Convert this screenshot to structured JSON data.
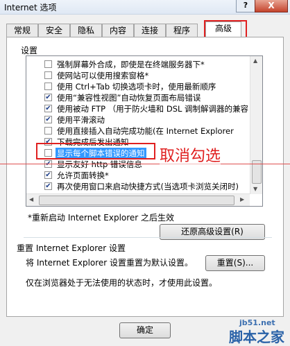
{
  "window": {
    "title": "Internet 选项",
    "help_glyph": "?",
    "close_glyph": "X"
  },
  "tabs": [
    {
      "label": "常规"
    },
    {
      "label": "安全"
    },
    {
      "label": "隐私"
    },
    {
      "label": "内容"
    },
    {
      "label": "连接"
    },
    {
      "label": "程序"
    },
    {
      "label": "高级",
      "active": true
    }
  ],
  "settings_label": "设置",
  "settings_items": [
    {
      "label": "强制屏幕外合成，即使是在终端服务器下*",
      "checked": false
    },
    {
      "label": "使网站可以使用搜索窗格*",
      "checked": false
    },
    {
      "label": "使用 Ctrl+Tab 切换选项卡时，使用最新顺序",
      "checked": false
    },
    {
      "label": "使用“兼容性视图”自动恢复页面布局错误",
      "checked": true
    },
    {
      "label": "使用被动 FTP （用于防火墙和 DSL 调制解调器的兼容",
      "checked": true
    },
    {
      "label": "使用平滑滚动",
      "checked": true
    },
    {
      "label": "使用直接插入自动完成功能(在 Internet Explorer",
      "checked": false
    },
    {
      "label": "下载完成后发出通知",
      "checked": true
    },
    {
      "label": "显示每个脚本错误的通知",
      "checked": false,
      "selected": true
    },
    {
      "label": "显示友好 http 错误信息",
      "checked": true
    },
    {
      "label": "允许页面转换*",
      "checked": true
    },
    {
      "label": "再次使用窗口来启动快捷方式(当选项卡浏览关闭时)",
      "checked": true
    }
  ],
  "restart_note": "*重新启动 Internet Explorer 之后生效",
  "restore_button": "还原高级设置(R)",
  "reset_section": {
    "title": "重置 Internet Explorer 设置",
    "desc": "将 Internet Explorer 设置重置为默认设置。",
    "reset_button": "重置(S)...",
    "note": "仅在浏览器处于无法使用的状态时，才使用此设置。"
  },
  "footer": {
    "ok_button": "确定"
  },
  "annotation": {
    "text": "取消勾选",
    "color": "#e02020"
  },
  "watermark": {
    "url": "jb51.net",
    "name": "脚本之家"
  }
}
